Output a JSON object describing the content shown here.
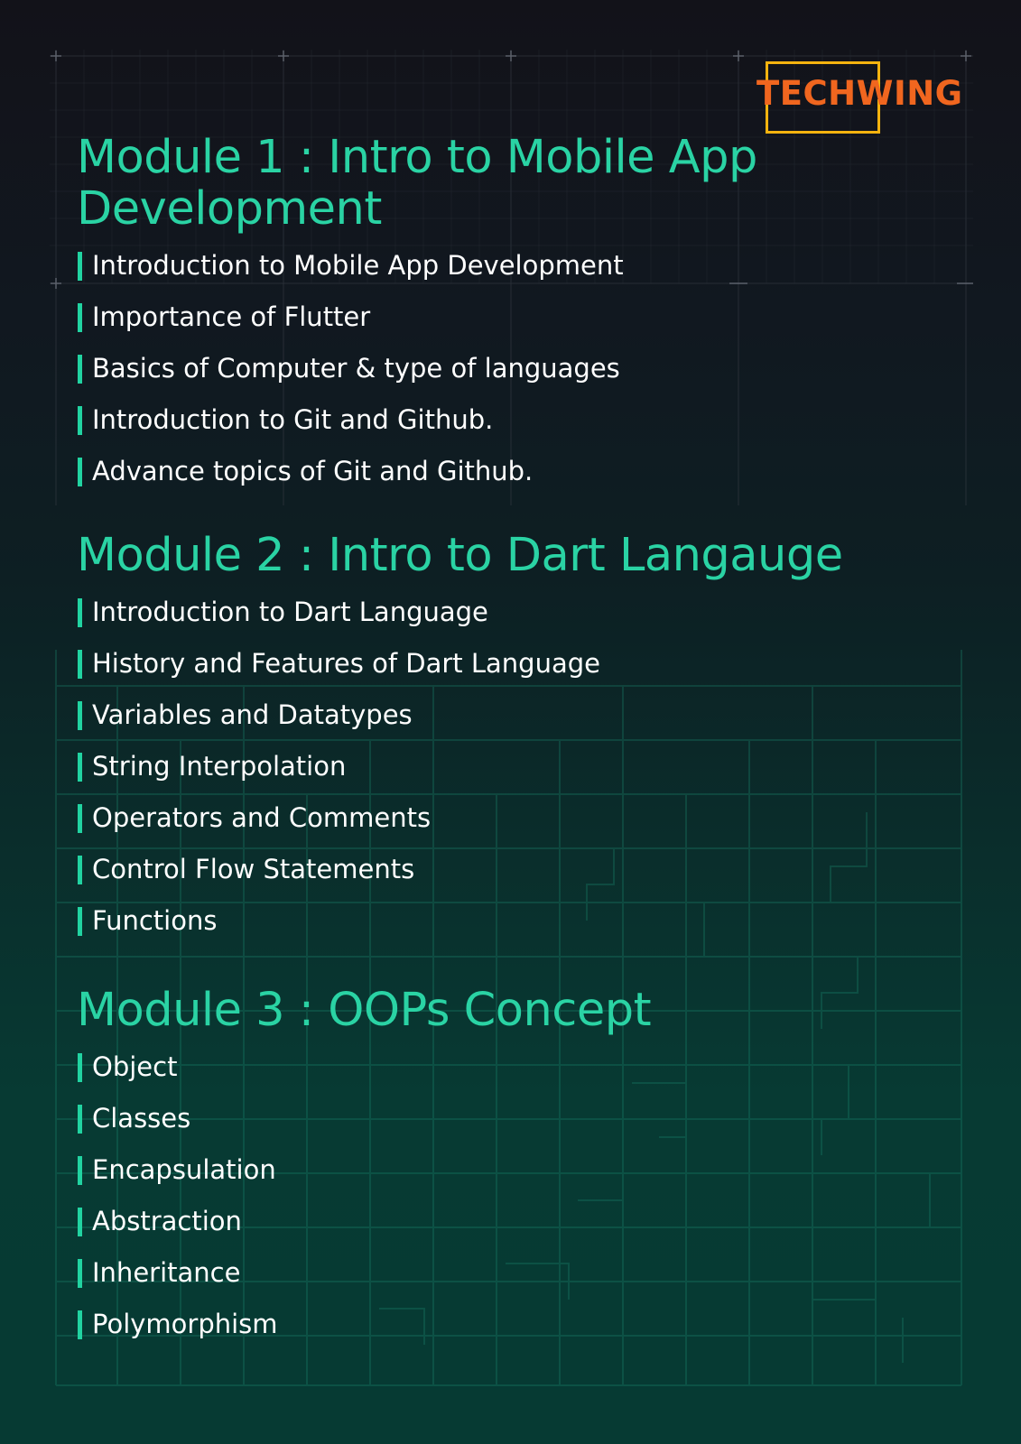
{
  "brand": {
    "logo_text": "TECHWING",
    "logo_color": "#f0661f",
    "frame_color": "#f5b30f"
  },
  "colors": {
    "title": "#2ad3a4",
    "bullet": "#21d3a1",
    "text": "#ffffff"
  },
  "modules": [
    {
      "title": "Module 1 : Intro to Mobile App Development",
      "topics": [
        "Introduction to Mobile App Development",
        "Importance of Flutter",
        "Basics of Computer & type of languages",
        "Introduction to Git and Github.",
        "Advance topics of Git and Github."
      ]
    },
    {
      "title": "Module 2 : Intro to Dart Langauge",
      "topics": [
        "Introduction to Dart Language",
        "History and Features of Dart Language",
        "Variables and Datatypes",
        "String Interpolation",
        "Operators and Comments",
        "Control Flow Statements",
        "Functions"
      ]
    },
    {
      "title": "Module 3 : OOPs Concept",
      "topics": [
        "Object",
        "Classes",
        "Encapsulation",
        "Abstraction",
        "Inheritance",
        "Polymorphism"
      ]
    }
  ]
}
